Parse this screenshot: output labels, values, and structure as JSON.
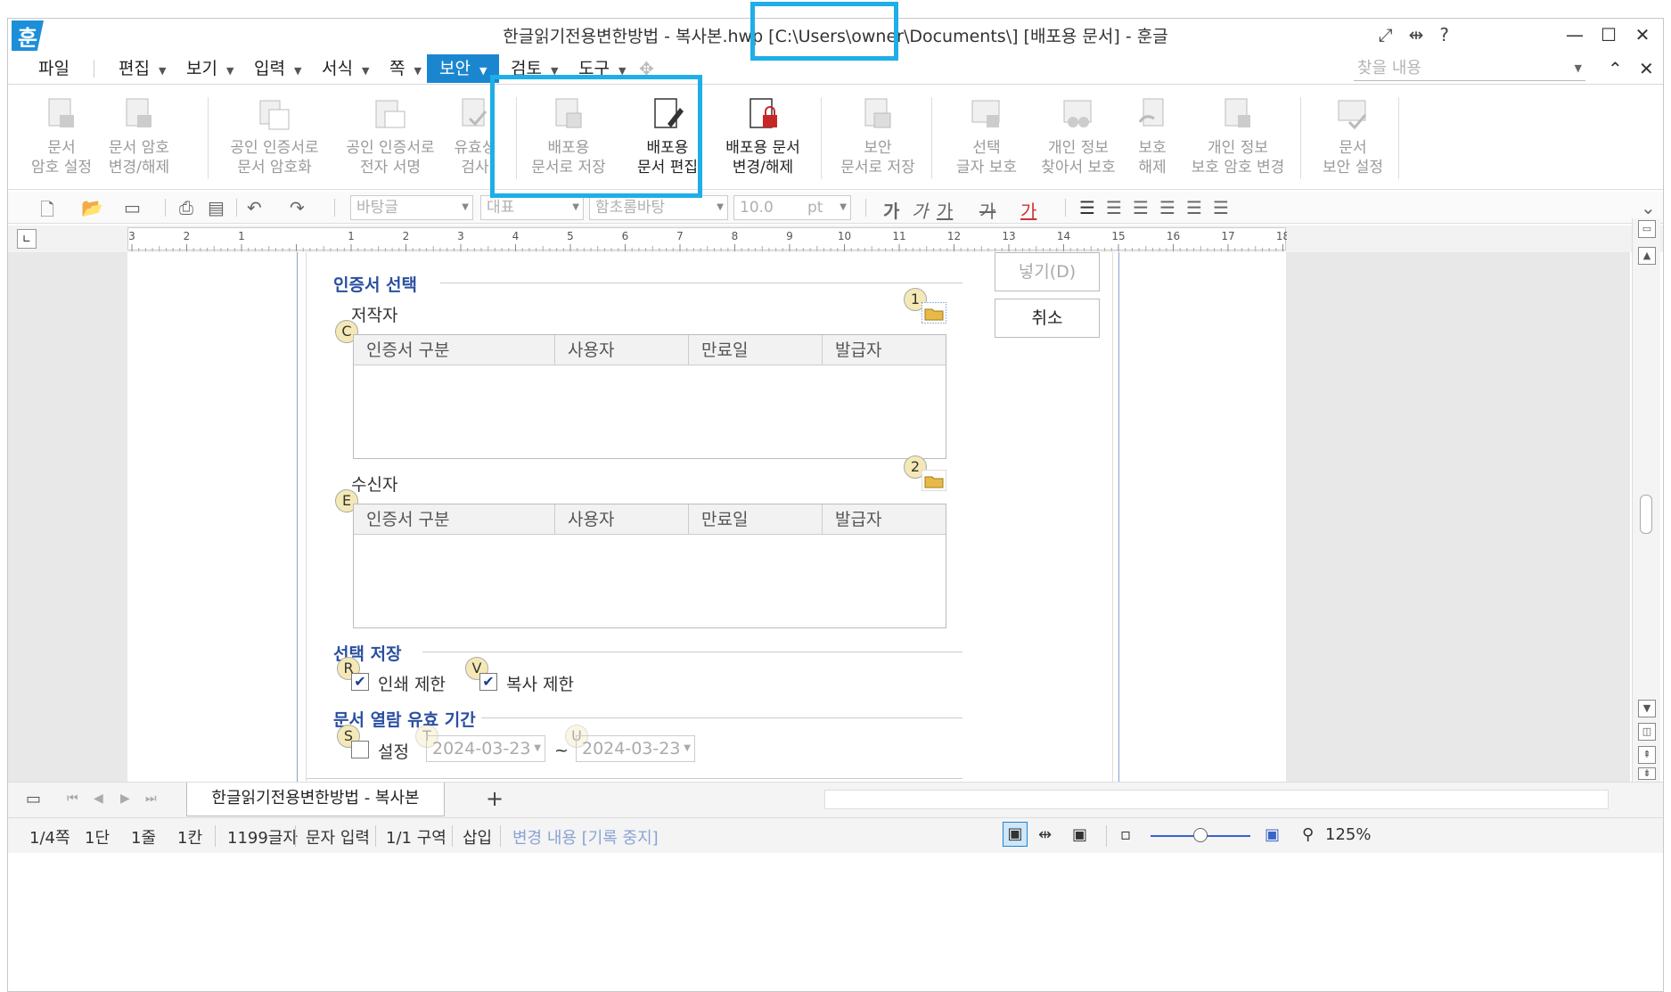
{
  "window": {
    "app_logo": "훈",
    "title": "한글읽기전용변한방법 - 복사본.hwp [C:\\Users\\owner\\Documents\\] [배포용 문서] - 훈글"
  },
  "menu": {
    "items": [
      {
        "label": "파일",
        "caret": false
      },
      {
        "label": "편집",
        "caret": true
      },
      {
        "label": "보기",
        "caret": true
      },
      {
        "label": "입력",
        "caret": true
      },
      {
        "label": "서식",
        "caret": true
      },
      {
        "label": "쪽",
        "caret": true
      },
      {
        "label": "보안",
        "caret": true,
        "active": true
      },
      {
        "label": "검토",
        "caret": true
      },
      {
        "label": "도구",
        "caret": true
      }
    ],
    "search_placeholder": "찾을 내용"
  },
  "ribbon": {
    "buttons": [
      {
        "line1": "문서",
        "line2": "암호 설정",
        "enabled": false
      },
      {
        "line1": "문서 암호",
        "line2": "변경/해제",
        "enabled": false
      },
      {
        "line1": "공인 인증서로",
        "line2": "문서 암호화",
        "enabled": false
      },
      {
        "line1": "공인 인증서로",
        "line2": "전자 서명",
        "enabled": false
      },
      {
        "line1": "유효성",
        "line2": "검사",
        "enabled": false
      },
      {
        "line1": "배포용",
        "line2": "문서로 저장",
        "enabled": false
      },
      {
        "line1": "배포용",
        "line2": "문서 편집",
        "enabled": true
      },
      {
        "line1": "배포용 문서",
        "line2": "변경/해제",
        "enabled": true
      },
      {
        "line1": "보안",
        "line2": "문서로 저장",
        "enabled": false
      },
      {
        "line1": "선택",
        "line2": "글자 보호",
        "enabled": false
      },
      {
        "line1": "개인 정보",
        "line2": "찾아서 보호",
        "enabled": false
      },
      {
        "line1": "보호",
        "line2": "해제",
        "enabled": false
      },
      {
        "line1": "개인 정보",
        "line2": "보호 암호 변경",
        "enabled": false
      },
      {
        "line1": "문서",
        "line2": "보안 설정",
        "enabled": false
      }
    ]
  },
  "toolbar": {
    "style": "바탕글",
    "lang": "대표",
    "font": "함초롬바탕",
    "size": "10.0",
    "unit": "pt",
    "bold": "가",
    "italic": "가",
    "underline": "가",
    "strike": "가",
    "color": "가"
  },
  "ruler": {
    "ticks": [
      "3",
      "2",
      "1",
      "",
      "1",
      "2",
      "3",
      "4",
      "5",
      "6",
      "7",
      "8",
      "9",
      "10",
      "11",
      "12",
      "13",
      "14",
      "15",
      "16",
      "17",
      "18"
    ]
  },
  "dialog": {
    "section_cert": "인증서 선택",
    "author_label": "저작자",
    "receiver_label": "수신자",
    "columns": [
      "인증서 구분",
      "사용자",
      "만료일",
      "발급자"
    ],
    "section_save": "선택 저장",
    "print_limit": "인쇄 제한",
    "copy_limit": "복사 제한",
    "section_period": "문서 열람 유효 기간",
    "period_label": "설정",
    "date_from": "2024-03-23",
    "date_to": "2024-03-23",
    "tilde": "~",
    "btn_insert": "넣기(D)",
    "btn_cancel": "취소",
    "badges": {
      "one": "1",
      "two": "2",
      "c": "C",
      "e": "E",
      "r": "R",
      "v": "V",
      "s": "S",
      "t": "T",
      "u": "U"
    }
  },
  "tabs": {
    "doc_tab": "한글읽기전용변한방법 - 복사본",
    "add": "+"
  },
  "status": {
    "page": "1/4쪽",
    "col": "1단",
    "line": "1줄",
    "char": "1칸",
    "count": "1199글자",
    "mode": "문자 입력",
    "section": "1/1 구역",
    "insert": "삽입",
    "track": "변경 내용 [기록 중지]",
    "zoom": "125%"
  },
  "colors": {
    "accent": "#1b86d0",
    "highlight": "#1eaee8",
    "section_title": "#2a4fa0"
  }
}
